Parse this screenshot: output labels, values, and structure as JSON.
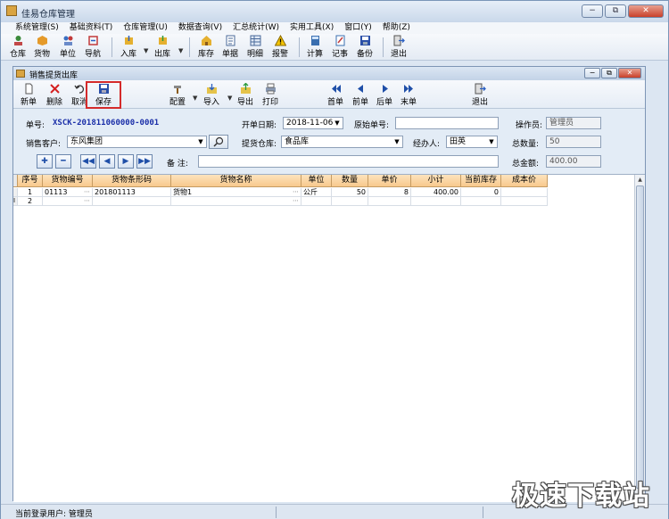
{
  "window": {
    "title": "佳易仓库管理"
  },
  "menu": [
    "系统管理(S)",
    "基础资料(T)",
    "仓库管理(U)",
    "数据查询(V)",
    "汇总统计(W)",
    "实用工具(X)",
    "窗口(Y)",
    "帮助(Z)"
  ],
  "toolbar1": [
    "仓库",
    "货物",
    "单位",
    "导航",
    "入库",
    "出库",
    "库存",
    "单据",
    "明细",
    "报警",
    "计算",
    "记事",
    "备份",
    "退出"
  ],
  "child": {
    "title": "销售提货出库",
    "toolbar": [
      "新单",
      "删除",
      "取消",
      "保存",
      "配置",
      "导入",
      "导出",
      "打印",
      "首单",
      "前单",
      "后单",
      "末单",
      "退出"
    ]
  },
  "form": {
    "order_no_label": "单号:",
    "order_no": "XSCK-201811060000-0001",
    "date_label": "开单日期:",
    "date": "2018-11-06",
    "orig_no_label": "原始单号:",
    "orig_no": "",
    "operator_label": "操作员:",
    "operator": "管理员",
    "customer_label": "销售客户:",
    "customer": "东风集团",
    "warehouse_label": "提货仓库:",
    "warehouse": "食品库",
    "handler_label": "经办人:",
    "handler": "田英",
    "total_qty_label": "总数量:",
    "total_qty": "50",
    "remark_label": "备 注:",
    "remark": "",
    "total_amount_label": "总金额:",
    "total_amount": "400.00"
  },
  "grid": {
    "columns": [
      "序号",
      "货物编号",
      "货物条形码",
      "货物名称",
      "单位",
      "数量",
      "单价",
      "小计",
      "当前库存",
      "成本价"
    ],
    "rows": [
      [
        "1",
        "01113",
        "201801113",
        "货物1",
        "公斤",
        "50",
        "8",
        "400.00",
        "0",
        ""
      ],
      [
        "2",
        "",
        "",
        "",
        "",
        "",
        "",
        "",
        "",
        ""
      ]
    ]
  },
  "status": {
    "user": "当前登录用户: 管理员"
  },
  "watermark": "极速下载站"
}
